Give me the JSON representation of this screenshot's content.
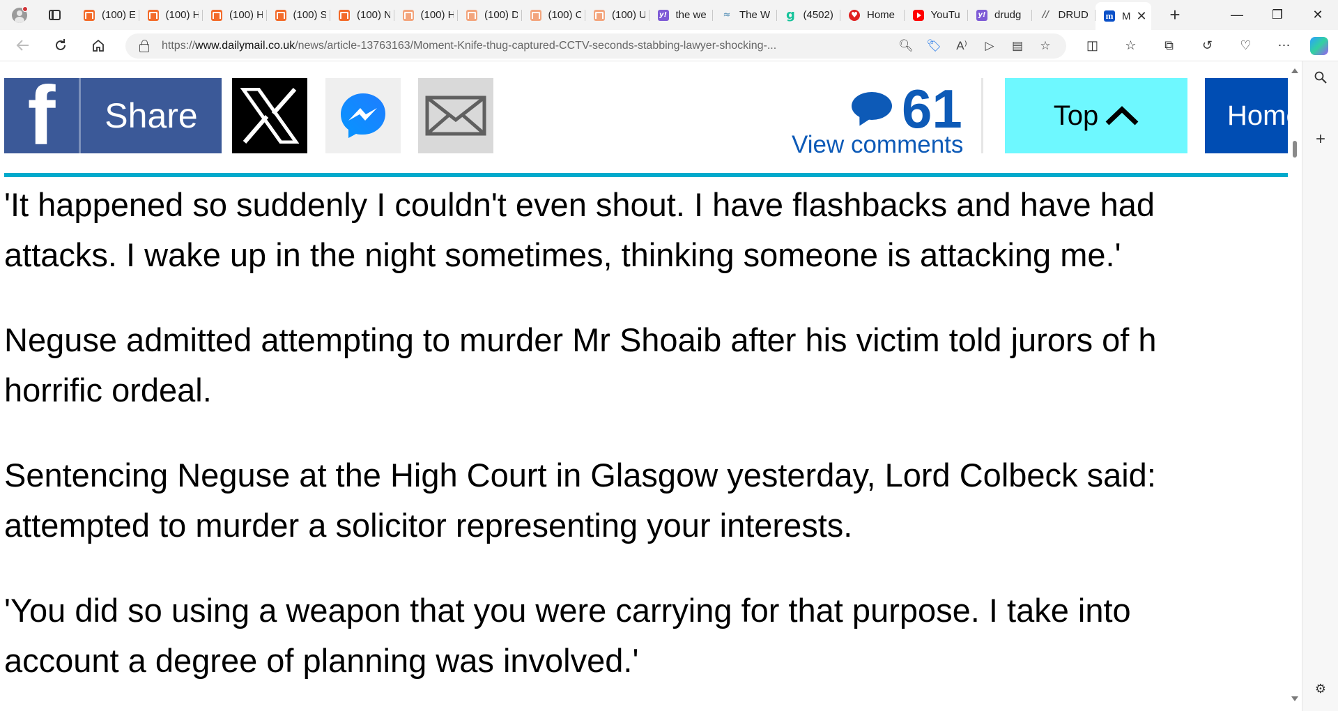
{
  "browser": {
    "tabs": [
      {
        "label": "(100) E",
        "icon": "podcast-icon"
      },
      {
        "label": "(100) H",
        "icon": "podcast-icon"
      },
      {
        "label": "(100) H",
        "icon": "podcast-icon"
      },
      {
        "label": "(100) S",
        "icon": "podcast-icon"
      },
      {
        "label": "(100) N",
        "icon": "podcast-icon"
      },
      {
        "label": "(100) H",
        "icon": "podcast-icon"
      },
      {
        "label": "(100) D",
        "icon": "podcast-icon"
      },
      {
        "label": "(100) C",
        "icon": "podcast-icon"
      },
      {
        "label": "(100) U",
        "icon": "podcast-icon"
      },
      {
        "label": "the we",
        "icon": "yahoo-icon"
      },
      {
        "label": "The W",
        "icon": "weather-icon"
      },
      {
        "label": "(4502)",
        "icon": "g-icon"
      },
      {
        "label": "Home",
        "icon": "home-icon"
      },
      {
        "label": "YouTu",
        "icon": "youtube-icon"
      },
      {
        "label": "drudg",
        "icon": "yahoo-icon"
      },
      {
        "label": "DRUD",
        "icon": "drudge-icon"
      }
    ],
    "active_tab": {
      "label": "M",
      "icon": "dailymail-icon",
      "close": "✕"
    },
    "new_tab": "+",
    "window_controls": {
      "minimize": "—",
      "restore": "❐",
      "close": "✕"
    },
    "url": {
      "prefix": "https://",
      "domain": "www.dailymail.co.uk",
      "path": "/news/article-13763163/Moment-Knife-thug-captured-CCTV-seconds-stabbing-lawyer-shocking-..."
    },
    "sidebar_add": "+"
  },
  "share_bar": {
    "facebook_label": "Share",
    "comments_count": "61",
    "view_comments": "View comments",
    "top_label": "Top",
    "home_label": "Home"
  },
  "article": {
    "paragraphs": [
      "'It happened so suddenly I couldn't even shout. I have flashbacks and have had\nattacks. I wake up in the night sometimes, thinking someone is attacking me.'",
      "Neguse admitted attempting to murder Mr Shoaib after his victim told jurors of h\nhorrific ordeal.",
      "Sentencing Neguse at the High Court in Glasgow yesterday, Lord Colbeck said: \nattempted to murder a solicitor representing your interests.",
      "'You did so using a weapon that you were carrying for that purpose. I take into\naccount a degree of planning was involved.'"
    ]
  },
  "colors": {
    "facebook": "#3b5998",
    "accent_rule": "#00aacc",
    "comments_blue": "#0d5ab7",
    "top_button": "#6ef8ff",
    "home_button": "#004db3"
  }
}
